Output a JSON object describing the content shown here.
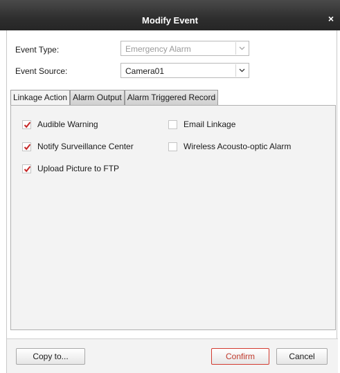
{
  "window": {
    "title": "Modify Event",
    "close_glyph": "×"
  },
  "form": {
    "event_type_label": "Event Type:",
    "event_type_value": "Emergency Alarm",
    "event_source_label": "Event Source:",
    "event_source_value": "Camera01"
  },
  "tabs": [
    {
      "label": "Linkage Action",
      "active": true
    },
    {
      "label": "Alarm Output",
      "active": false
    },
    {
      "label": "Alarm Triggered Record",
      "active": false
    }
  ],
  "options": {
    "audible_warning": {
      "label": "Audible Warning",
      "checked": true
    },
    "email_linkage": {
      "label": "Email Linkage",
      "checked": false
    },
    "notify_center": {
      "label": "Notify Surveillance Center",
      "checked": true
    },
    "wireless_alarm": {
      "label": "Wireless Acousto-optic Alarm",
      "checked": false
    },
    "upload_ftp": {
      "label": "Upload Picture to FTP",
      "checked": true
    }
  },
  "buttons": {
    "copy_to": "Copy to...",
    "confirm": "Confirm",
    "cancel": "Cancel"
  },
  "colors": {
    "accent": "#c0392b",
    "check": "#c62828",
    "titlebar": "#2e2e2e"
  },
  "icons": {
    "close": "close-icon",
    "dropdown": "chevron-down-icon",
    "check": "checkmark-icon"
  }
}
